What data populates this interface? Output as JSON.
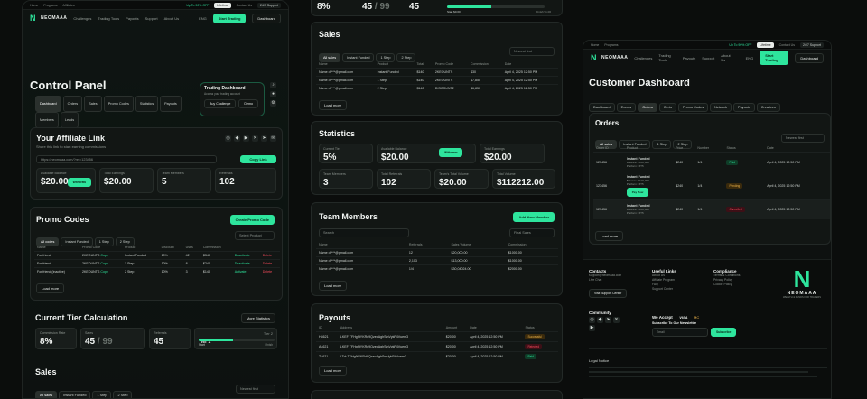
{
  "frame1": {
    "topbar": {
      "links": [
        "Home",
        "Programs",
        "Affiliates"
      ],
      "promo": "Up To 90% OFF",
      "countdown": "Lifetime",
      "contact": "Contact Us",
      "support": "24/7 Support"
    },
    "nav": {
      "brand": "NEOMAAA",
      "items": [
        "Challenges",
        "Trading Tools",
        "Payouts",
        "Support",
        "About Us"
      ],
      "lang": "ENG",
      "start": "Start Trading",
      "dashboard": "Dashboard"
    },
    "title": "Control Panel",
    "tabs": [
      "Dashboard",
      "Orders",
      "Sales",
      "Promo Codes",
      "Statistics",
      "Payouts",
      "Members",
      "Leads"
    ],
    "trading": {
      "title": "Trading Dashboard",
      "sub": "Access your trading account",
      "buy": "Buy Challenge",
      "demo": "Demo"
    },
    "affiliate": {
      "title": "Your Affiliate Link",
      "sub": "Share this link to start earning commissions",
      "link": "https://neomaaa.com/?ref=123456",
      "copy": "Copy Link",
      "stats": [
        {
          "label": "Available Balance",
          "value": "$20.00",
          "extra": "Withdraw"
        },
        {
          "label": "Total Earnings",
          "value": "$20.00"
        },
        {
          "label": "Team Members",
          "value": "5"
        },
        {
          "label": "Referrals",
          "value": "102"
        }
      ]
    },
    "promo": {
      "title": "Promo Codes",
      "create": "Create Promo Code",
      "filters": [
        "All codes",
        "Instant Funded",
        "1 Step",
        "2 Step"
      ],
      "select": "Select Product",
      "cols": [
        "Name",
        "Promo Code",
        "Product",
        "Discount",
        "Uses",
        "Commission",
        "",
        ""
      ],
      "rows": [
        [
          "For friend",
          "2KEOUNTS",
          "Instant Funded",
          "10%",
          "42",
          "$340",
          "Deactivate",
          "Delete"
        ],
        [
          "For friend",
          "2KEOUNTS",
          "1 Step",
          "10%",
          "8",
          "$240",
          "Deactivate",
          "Delete"
        ],
        [
          "For friend (inactive)",
          "2KEOUNTS",
          "2 Step",
          "10%",
          "3",
          "$140",
          "Activate",
          "Delete"
        ]
      ],
      "copy": "Copy",
      "load": "Load more"
    },
    "tier": {
      "title": "Current Tier Calculation",
      "more": "More Statistics",
      "rate_label": "Commission Rate",
      "rate": "8%",
      "sales_label": "Sales",
      "sales": "45",
      "sales_max": "99",
      "ref_label": "Referrals",
      "ref": "45",
      "tier1": "Tier 1",
      "tier2": "Tier 2",
      "progress_label": "45/99",
      "start": "Start",
      "finish": "Finish",
      "progress": 0.45
    },
    "sales": {
      "title": "Sales",
      "filters": [
        "All sales",
        "Instant Funded",
        "1 Step",
        "2 Step"
      ],
      "select": "Newest first"
    }
  },
  "frame2": {
    "top": {
      "rate": "8%",
      "sales": "45",
      "sales_max": "99",
      "ref": "45",
      "start": "Start $0.00",
      "finish": "Finish $1.00"
    },
    "sales": {
      "title": "Sales",
      "filters": [
        "All sales",
        "Instant Funded",
        "1 Step",
        "2 Step"
      ],
      "select": "Newest first",
      "cols": [
        "Name",
        "Product",
        "Total",
        "Promo Code",
        "Commission",
        "Date"
      ],
      "rows": [
        [
          "Name d****@gmail.com",
          "Instant Funded",
          "$140",
          "2KEOUNTS",
          "$30",
          "April 4, 2025 12:50 PM"
        ],
        [
          "Name d****@gmail.com",
          "1 Step",
          "$140",
          "2KEOUNTS",
          "$7,850",
          "April 4, 2025 12:50 PM"
        ],
        [
          "Name d****@gmail.com",
          "2 Step",
          "$140",
          "DISCOUNT2",
          "$6,850",
          "April 4, 2025 12:50 PM"
        ]
      ],
      "load": "Load more"
    },
    "stats": {
      "title": "Statistics",
      "cells": [
        {
          "l": "Current Tier",
          "v": "5%"
        },
        {
          "l": "Available Balance",
          "v": "$20.00",
          "extra": "Withdraw"
        },
        {
          "l": "Total Earnings",
          "v": "$20.00"
        },
        {
          "l": "Team Members",
          "v": "3"
        },
        {
          "l": "Total Referrals",
          "v": "102"
        },
        {
          "l": "Team's Total Volume",
          "v": "$20.00"
        },
        {
          "l": "Total Volume",
          "v": "$112212.00"
        }
      ]
    },
    "team": {
      "title": "Team Members",
      "add": "Add New Member",
      "search": "Search",
      "select": "Final Sales",
      "cols": [
        "Name",
        "Referrals",
        "Sales Volume",
        "Commission"
      ],
      "rows": [
        [
          "Name d****@gmail.com",
          "12",
          "$20,000.00",
          "$1000.00"
        ],
        [
          "Name d****@gmail.com",
          "2,103",
          "$13,000.00",
          "$1000.00"
        ],
        [
          "Name d****@gmail.com",
          "1/4",
          "$30,04024.00",
          "$2000.00"
        ]
      ],
      "load": "Load more"
    },
    "payouts": {
      "title": "Payouts",
      "cols": [
        "ID",
        "Address",
        "Amount",
        "Date",
        "Status"
      ],
      "rows": [
        [
          "H4621",
          "LKEF TFHg9tYKRd9QzeoAghSmVykP4Vuem3",
          "$20.00",
          "April 4, 2025 12:50 PM",
          "Successful"
        ],
        [
          "A4621",
          "LKEF TFHg9tYKRd9QzeoAghSmVykP4Vuem3",
          "$20.00",
          "April 4, 2025 12:50 PM",
          "Rejected"
        ],
        [
          "T4621",
          "LTrk TFHg9tYKRd9QzeoAghSmVykP4Vuem3",
          "$20.00",
          "April 4, 2025 12:50 PM",
          "Paid"
        ]
      ],
      "load": "Load more"
    }
  },
  "frame3": {
    "topbar": {
      "links": [
        "Home",
        "Programs"
      ],
      "promo": "Up To 90% OFF",
      "countdown": "Lifetime",
      "contact": "Contact Us",
      "support": "24/7 Support"
    },
    "nav": {
      "brand": "NEOMAAA",
      "items": [
        "Challenges",
        "Trading Tools",
        "Payouts",
        "Support",
        "About Us"
      ],
      "lang": "ENG",
      "start": "Start Trading",
      "dashboard": "Dashboard"
    },
    "title": "Customer Dashboard",
    "tabs": [
      "Dashboard",
      "Events",
      "Orders",
      "Certs",
      "Promo Codes",
      "Network",
      "Payouts",
      "Creatives"
    ],
    "orders": {
      "title": "Orders",
      "filters": [
        "All sales",
        "Instant Funded",
        "1 Step",
        "2 Step"
      ],
      "select": "Newest first",
      "cols": [
        "Order ID",
        "Product",
        "Price",
        "Number",
        "Status",
        "Date"
      ],
      "rows": [
        {
          "id": "123456",
          "p1": "Instant Funded",
          "p2": "Balance: $100,000",
          "p3": "Platform: MT5",
          "price": "$240",
          "num": "1/4",
          "status": "Paid",
          "date": "April 4, 2025 12:50 PM"
        },
        {
          "id": "123456",
          "p1": "Instant Funded",
          "p2": "Balance: $100,000",
          "p3": "Platform: MT5",
          "price": "$240",
          "num": "1/4",
          "status": "Pending",
          "date": "April 4, 2025 12:50 PM",
          "pay": "Pay Now"
        },
        {
          "id": "123456",
          "p1": "Instant Funded",
          "p2": "Balance: $100,000",
          "p3": "Platform: MT5",
          "price": "$240",
          "num": "1/4",
          "status": "Cancelled",
          "date": "April 4, 2025 12:50 PM"
        }
      ],
      "load": "Load more"
    },
    "footer": {
      "contacts": "Contacts",
      "contact_lines": [
        "support@neomaaa.com",
        "Live Chat"
      ],
      "support_btn": "Visit Support Center",
      "useful": "Useful Links",
      "useful_items": [
        "About Us",
        "Affiliate Program",
        "FAQ",
        "Support Center"
      ],
      "compliance": "Compliance",
      "compliance_items": [
        "Terms & Conditions",
        "Privacy Policy",
        "Cookie Policy"
      ],
      "community": "Community",
      "accept": "We Accept",
      "cards": [
        "VISA",
        "MC"
      ],
      "subscribe": "Subscribe To Our Newsletter",
      "email_ph": "Email",
      "sub_btn": "Subscribe",
      "brand": "NEOMAAA",
      "tagline": "WEALTH & FUNDS FOR TRADERS",
      "legal": "Legal Notice"
    }
  }
}
